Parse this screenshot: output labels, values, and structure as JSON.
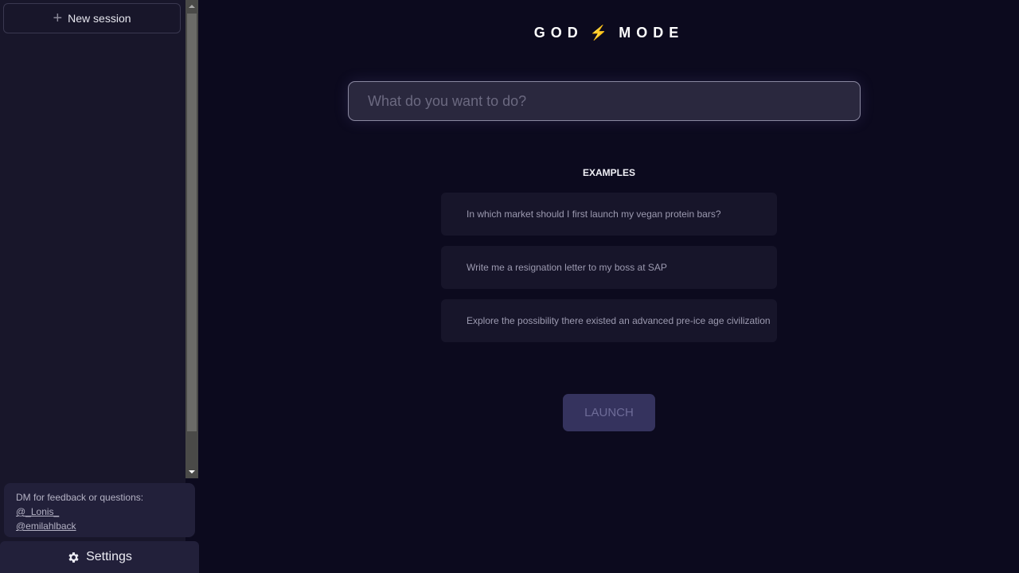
{
  "sidebar": {
    "new_session_label": "New session",
    "feedback": {
      "text": "DM for feedback or questions:",
      "links": [
        "@_Lonis_",
        "@emilahlback"
      ]
    },
    "settings_label": "Settings"
  },
  "header": {
    "title_left": "GOD",
    "title_icon": "⚡",
    "title_right": "MODE"
  },
  "prompt": {
    "value": "",
    "placeholder": "What do you want to do?"
  },
  "examples": {
    "title": "EXAMPLES",
    "items": [
      "In which market should I first launch my vegan protein bars?",
      "Write me a resignation letter to my boss at SAP",
      "Explore the possibility there existed an advanced pre-ice age civilization"
    ]
  },
  "launch_label": "LAUNCH",
  "colors": {
    "background": "#0c0a1e",
    "sidebar": "#18162a",
    "accent_bolt": "#f5b82e",
    "launch_button": "#35335e"
  }
}
